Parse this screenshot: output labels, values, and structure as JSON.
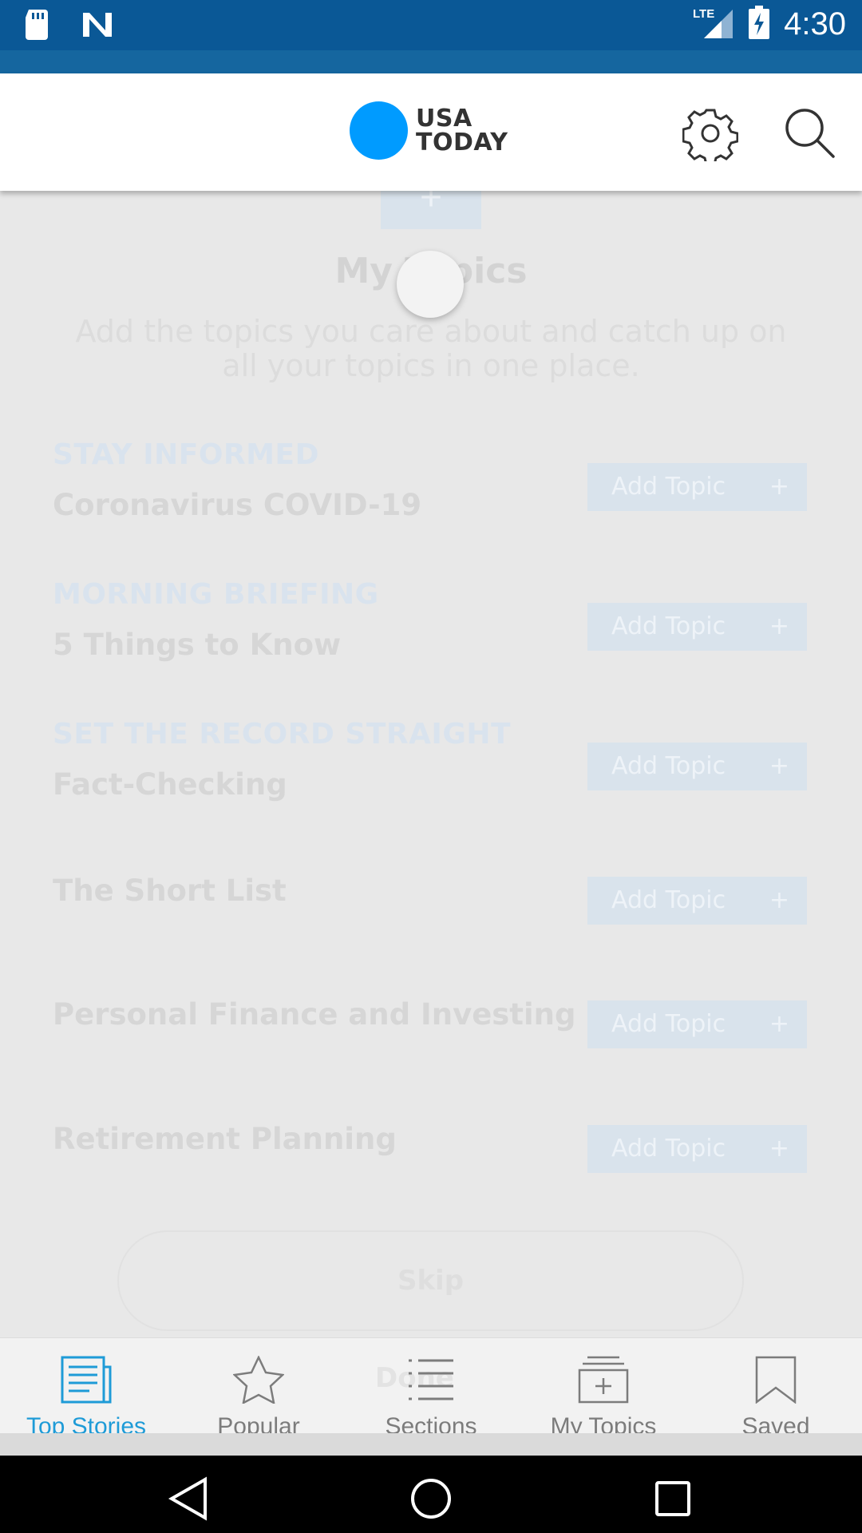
{
  "status_bar": {
    "time": "4:30",
    "network": "LTE",
    "icons": [
      "sd-card-icon",
      "n-notification-icon",
      "lte-signal-icon",
      "battery-charging-icon"
    ]
  },
  "header": {
    "logo_line1": "USA",
    "logo_line2": "TODAY",
    "icons": [
      "gear-icon",
      "search-icon"
    ],
    "colors": {
      "logo_dot": "#009bff",
      "text": "#333333"
    }
  },
  "my_topics": {
    "plus_symbol": "+",
    "title": "My Topics",
    "subtitle": "Add the topics you care about and catch up on all your topics in one place."
  },
  "topics": [
    {
      "kicker": "STAY INFORMED",
      "name": "Coronavirus COVID-19",
      "button": "Add Topic"
    },
    {
      "kicker": "MORNING BRIEFING",
      "name": "5 Things to Know",
      "button": "Add Topic"
    },
    {
      "kicker": "SET THE RECORD STRAIGHT",
      "name": "Fact-Checking",
      "button": "Add Topic"
    },
    {
      "kicker": "",
      "name": "The Short List",
      "button": "Add Topic"
    },
    {
      "kicker": "",
      "name": "Personal Finance and Investing",
      "button": "Add Topic"
    },
    {
      "kicker": "",
      "name": "Retirement Planning",
      "button": "Add Topic"
    }
  ],
  "add_plus": "+",
  "skip_label": "Skip",
  "ghost_label": "Done",
  "bottom_nav": [
    {
      "label": "Top Stories",
      "icon": "newspaper-icon",
      "active": true
    },
    {
      "label": "Popular",
      "icon": "star-icon",
      "active": false
    },
    {
      "label": "Sections",
      "icon": "list-icon",
      "active": false
    },
    {
      "label": "My Topics",
      "icon": "add-folder-icon",
      "active": false
    },
    {
      "label": "Saved",
      "icon": "bookmark-icon",
      "active": false
    }
  ],
  "system_nav": [
    "back-icon",
    "home-icon",
    "recents-icon"
  ],
  "accent_color": "#1e9bd7"
}
